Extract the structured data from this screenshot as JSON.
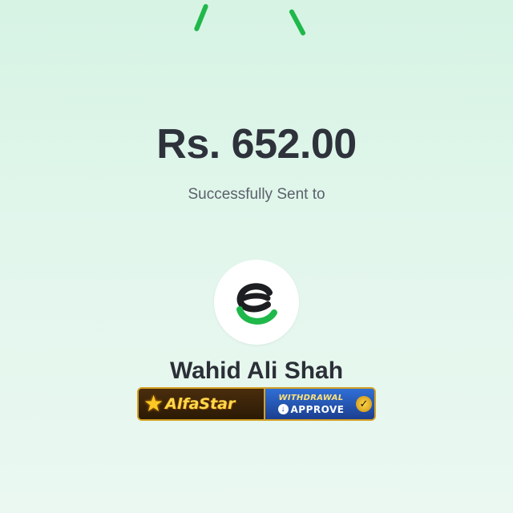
{
  "transaction": {
    "amount": "Rs. 652.00",
    "status": "Successfully Sent to",
    "recipient_name": "Wahid Ali Shah"
  },
  "brand_logo": {
    "icon": "easypaisa-logo-icon"
  },
  "ad_banner": {
    "brand": "AlfaStar",
    "badge_top": "WITHDRAWAL",
    "badge_bottom": "APPROVE",
    "icons": [
      "star-icon",
      "download-icon",
      "check-badge-icon"
    ]
  },
  "colors": {
    "accent_green": "#1fb84a",
    "text_dark": "#2e323b",
    "text_muted": "#5b606a",
    "banner_gold": "#d4a125",
    "banner_blue": "#2f6fd6"
  }
}
